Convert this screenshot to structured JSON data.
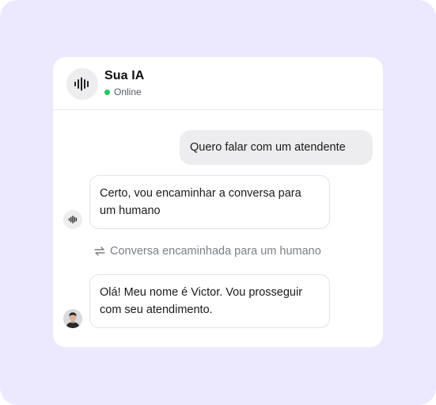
{
  "colors": {
    "background": "#ECE9FE",
    "card": "#ffffff",
    "user_bubble": "#EDEDEF",
    "online": "#22C55E",
    "muted_text": "#7b7f86"
  },
  "header": {
    "agent_name": "Sua IA",
    "status": "Online",
    "avatar_icon": "audio-waveform-icon"
  },
  "messages": [
    {
      "sender": "user",
      "text": "Quero falar com um atendente"
    },
    {
      "sender": "ai",
      "text": "Certo, vou encaminhar a conversa para um humano",
      "avatar_icon": "audio-waveform-icon"
    },
    {
      "sender": "human",
      "text": "Olá! Meu nome é Victor. Vou prosseguir com seu atendimento.",
      "avatar": "person-photo"
    }
  ],
  "handoff": {
    "icon": "transfer-arrows-icon",
    "text": "Conversa encaminhada para um humano"
  }
}
